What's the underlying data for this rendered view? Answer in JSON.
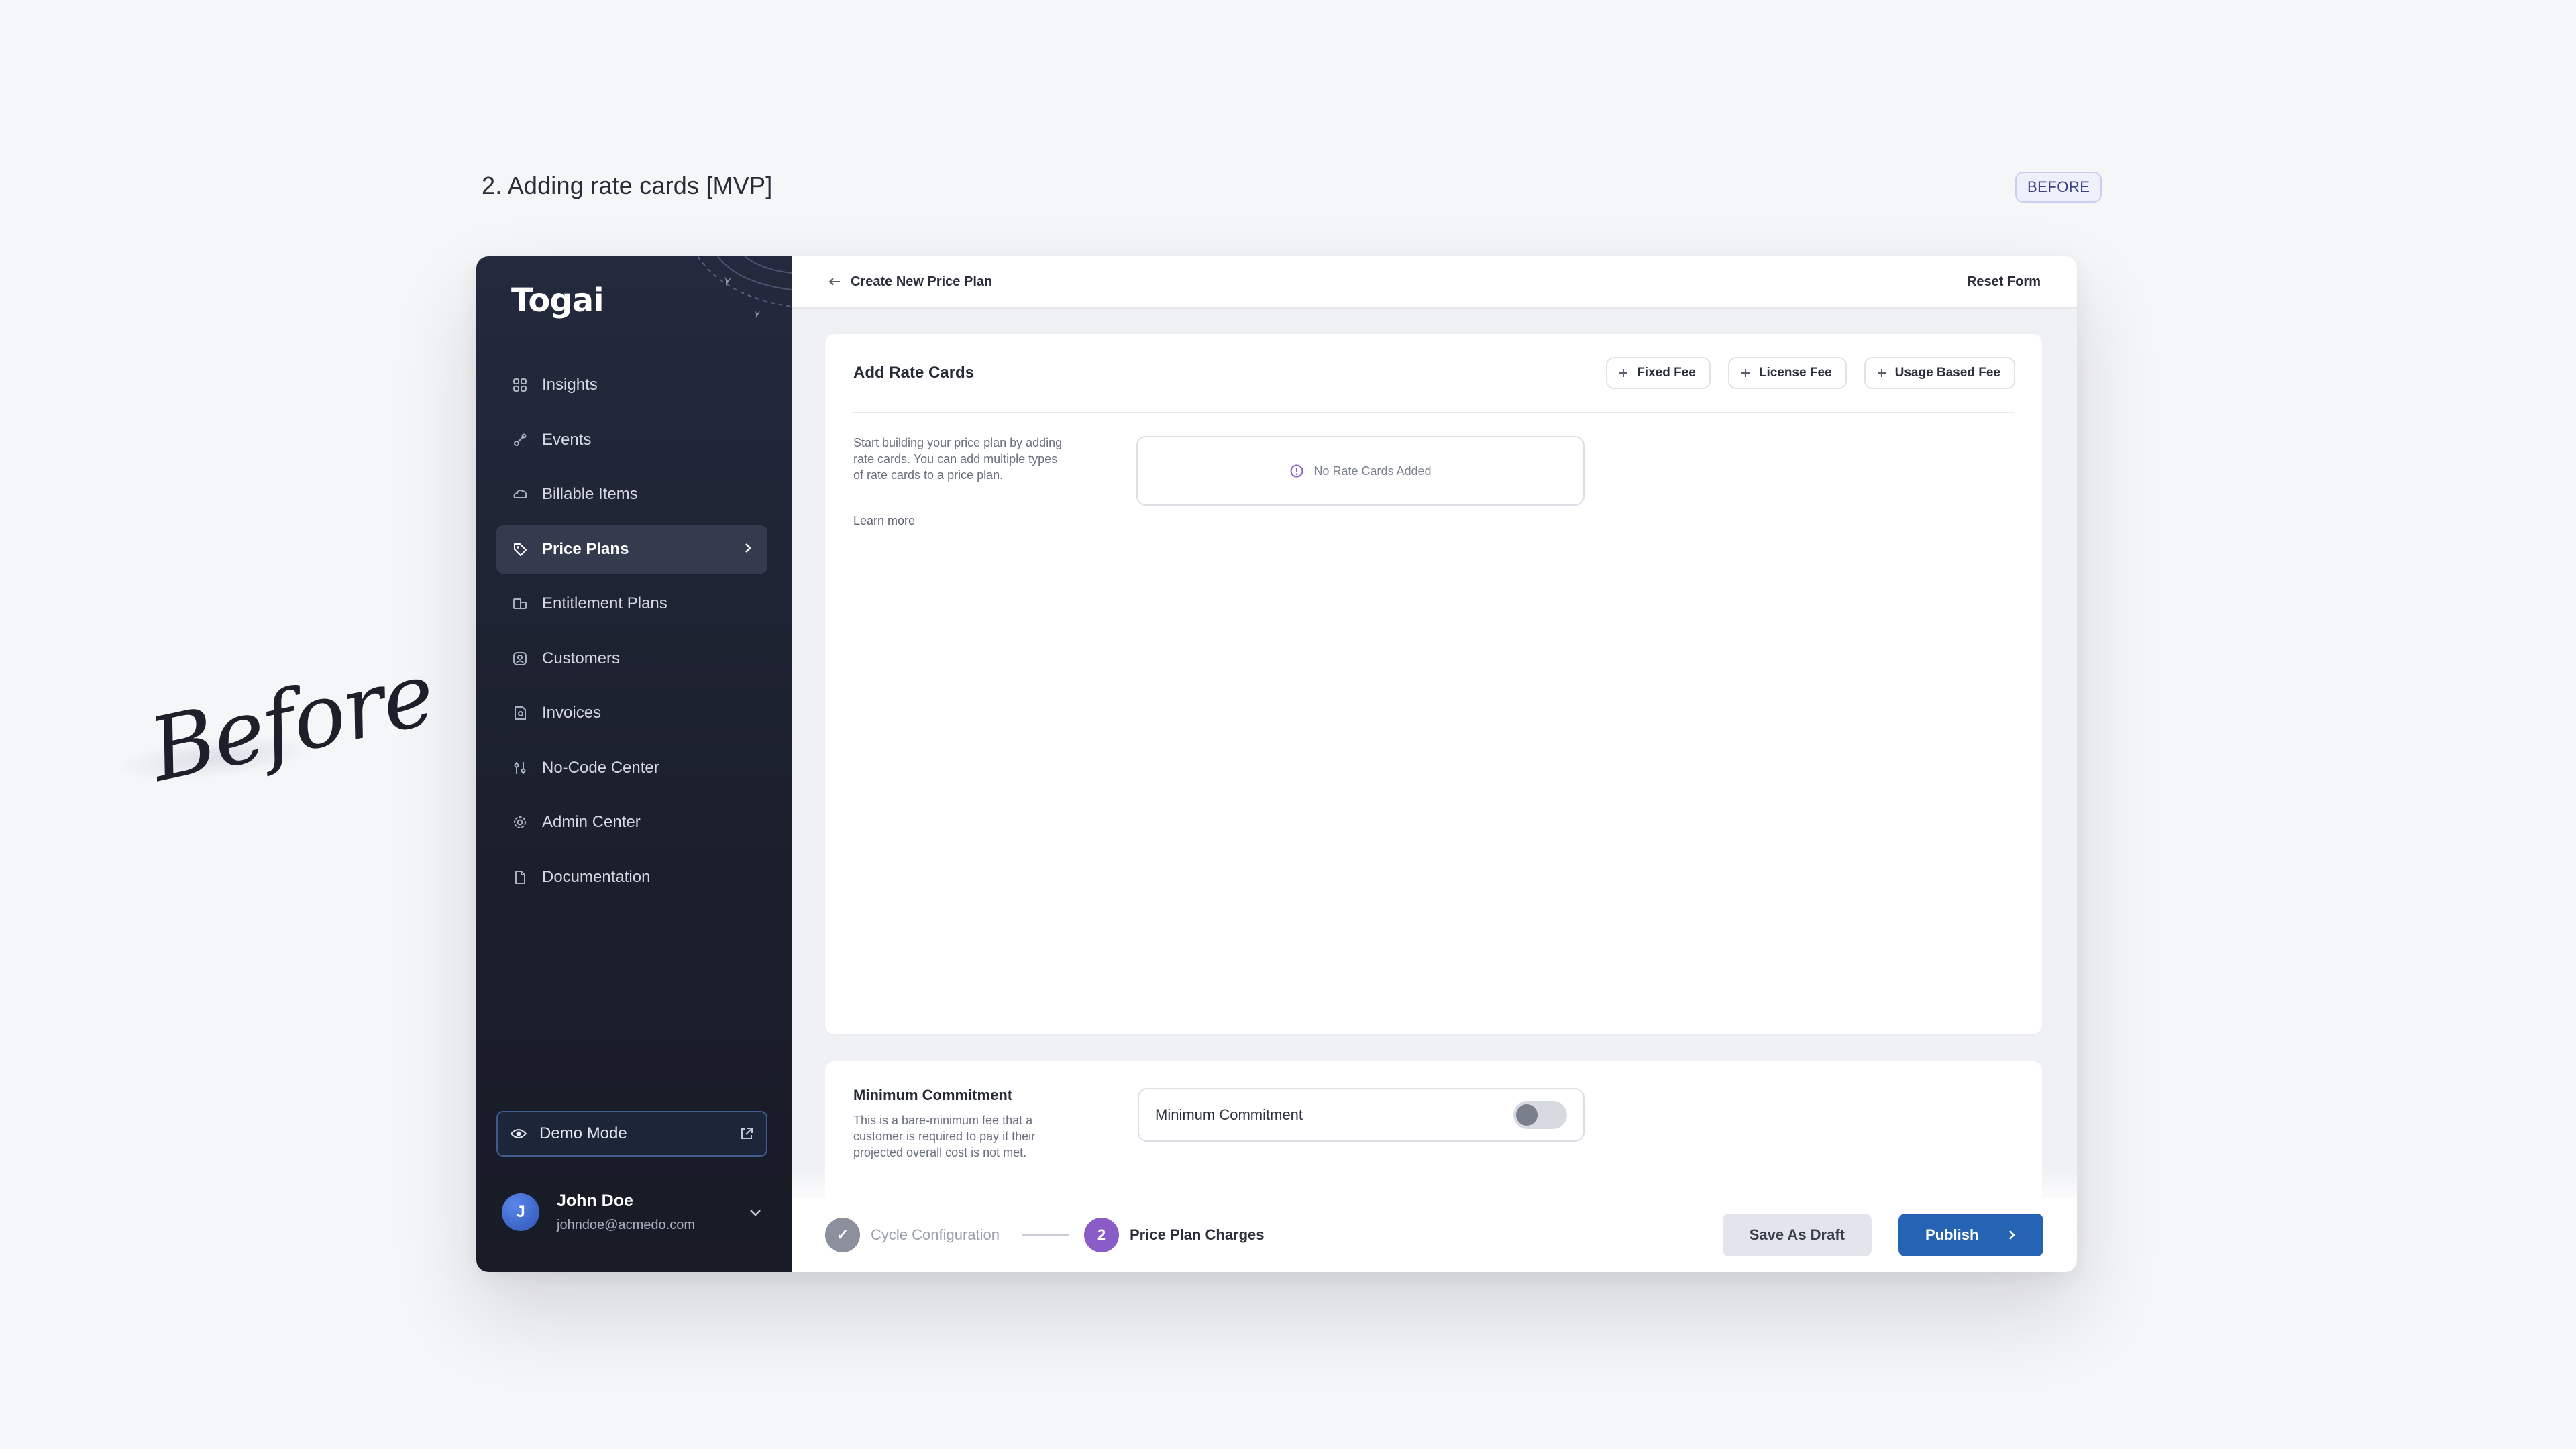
{
  "page": {
    "heading": "2. Adding rate cards [MVP]",
    "badge": "BEFORE",
    "script_label": "Before"
  },
  "sidebar": {
    "logo": "Togai",
    "items": [
      {
        "label": "Insights",
        "icon": "grid-icon"
      },
      {
        "label": "Events",
        "icon": "events-icon"
      },
      {
        "label": "Billable Items",
        "icon": "cloud-icon"
      },
      {
        "label": "Price Plans",
        "icon": "tag-icon",
        "active": true
      },
      {
        "label": "Entitlement Plans",
        "icon": "entitlement-icon"
      },
      {
        "label": "Customers",
        "icon": "customers-icon"
      },
      {
        "label": "Invoices",
        "icon": "invoice-icon"
      },
      {
        "label": "No-Code Center",
        "icon": "sliders-icon"
      },
      {
        "label": "Admin Center",
        "icon": "gear-icon"
      },
      {
        "label": "Documentation",
        "icon": "document-icon"
      }
    ],
    "demo_mode": "Demo Mode",
    "user": {
      "initial": "J",
      "name": "John Doe",
      "email": "johndoe@acmedo.com"
    }
  },
  "topbar": {
    "title": "Create New Price Plan",
    "reset": "Reset Form"
  },
  "rate_cards": {
    "title": "Add Rate Cards",
    "buttons": [
      "Fixed Fee",
      "License Fee",
      "Usage Based Fee"
    ],
    "description": "Start building your price plan by adding rate cards. You can add multiple types of rate cards to a price plan.",
    "learn_more": "Learn more",
    "empty_state": "No Rate Cards Added"
  },
  "minimum_commitment": {
    "title": "Minimum Commitment",
    "description": "This is a bare-minimum fee that a customer is required to pay if their projected overall cost is not met.",
    "field_label": "Minimum Commitment",
    "toggle_on": false
  },
  "footer": {
    "steps": [
      {
        "label": "Cycle Configuration",
        "state": "done",
        "marker": "✓"
      },
      {
        "label": "Price Plan Charges",
        "state": "current",
        "marker": "2"
      }
    ],
    "save_draft": "Save As Draft",
    "publish": "Publish"
  },
  "colors": {
    "sidebar_bg": "#1f2434",
    "accent_blue": "#2563b4",
    "step_purple": "#8a5cc8"
  }
}
